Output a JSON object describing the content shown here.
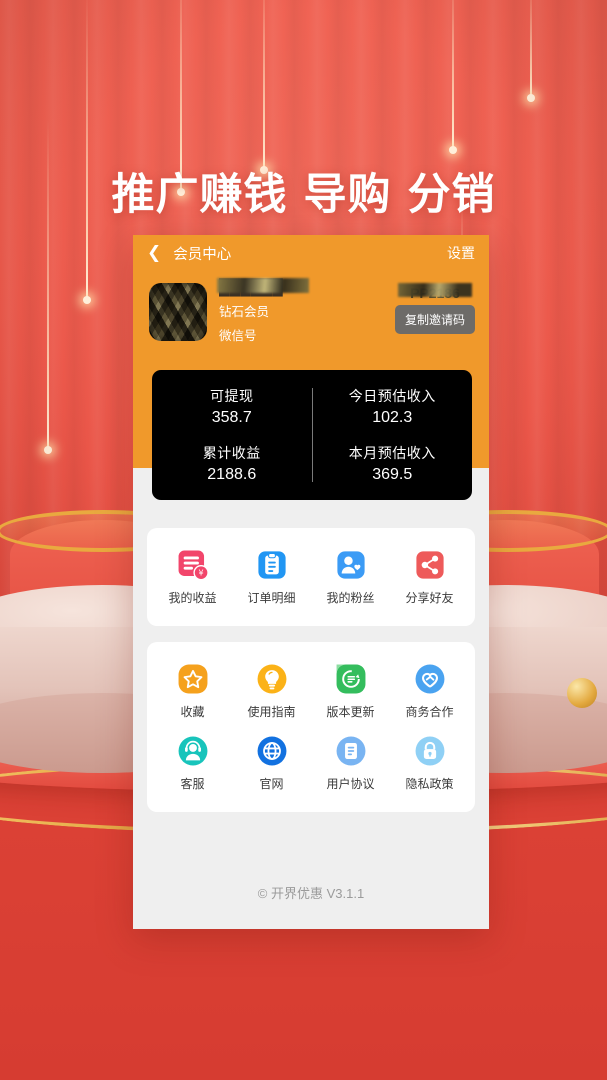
{
  "headline": "推广赚钱 导购 分销",
  "colors": {
    "background_red": "#e8564a",
    "header_orange": "#f0992b",
    "panel_black": "#000000",
    "body_gray": "#efefef",
    "copy_button_gray": "#6d6b68"
  },
  "navbar": {
    "back_icon": "chevron-left-icon",
    "title": "会员中心",
    "settings_label": "设置"
  },
  "profile": {
    "avatar_alt": "用户头像",
    "username": "██████",
    "level": "钻石会员",
    "wechat_label": "微信号",
    "invite_code": "PP2186",
    "copy_button_label": "复制邀请码"
  },
  "stats": {
    "left": [
      {
        "label": "可提现",
        "value": "358.7"
      },
      {
        "label": "累计收益",
        "value": "2188.6"
      }
    ],
    "right": [
      {
        "label": "今日预估收入",
        "value": "102.3"
      },
      {
        "label": "本月预估收入",
        "value": "369.5"
      }
    ]
  },
  "quick_actions": [
    {
      "label": "我的收益",
      "icon": "income-document-yen-icon",
      "color": "#f2456b"
    },
    {
      "label": "订单明细",
      "icon": "clipboard-order-icon",
      "color": "#2196f3"
    },
    {
      "label": "我的粉丝",
      "icon": "person-heart-fans-icon",
      "color": "#3b9bf5"
    },
    {
      "label": "分享好友",
      "icon": "share-nodes-icon",
      "color": "#ee5a5a"
    }
  ],
  "menu_items": [
    {
      "label": "收藏",
      "icon": "star-favorite-icon",
      "color": "#f5a11d"
    },
    {
      "label": "使用指南",
      "icon": "lightbulb-guide-icon",
      "color": "#fbb217"
    },
    {
      "label": "版本更新",
      "icon": "version-update-icon",
      "color": "#34bd5d"
    },
    {
      "label": "商务合作",
      "icon": "handshake-hearts-icon",
      "color": "#4aa3f0"
    },
    {
      "label": "客服",
      "icon": "headset-support-icon",
      "color": "#18c4bb"
    },
    {
      "label": "官网",
      "icon": "globe-website-icon",
      "color": "#1271e0"
    },
    {
      "label": "用户协议",
      "icon": "document-agreement-icon",
      "color": "#79b4f2"
    },
    {
      "label": "隐私政策",
      "icon": "lock-privacy-icon",
      "color": "#8fd0f5"
    }
  ],
  "footer": "© 开界优惠 V3.1.1"
}
